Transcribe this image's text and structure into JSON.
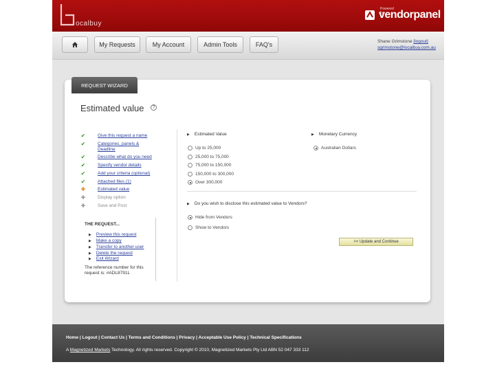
{
  "brand": {
    "logo_text": "ocalbuy",
    "powered_by": "Powered by",
    "vendorpanel": "vendorpanel"
  },
  "nav": {
    "items": [
      {
        "label": "My Requests"
      },
      {
        "label": "My Account"
      },
      {
        "label": "Admin Tools"
      },
      {
        "label": "FAQ's"
      }
    ]
  },
  "user": {
    "name": "Shane Grimstone",
    "logout": "[logout]",
    "email": "sgrimstone@localbuy.com.au"
  },
  "wizard": {
    "tab_label": "REQUEST WIZARD",
    "title": "Estimated value",
    "help": "?",
    "steps": [
      {
        "label": "Give this request a name",
        "status": "done"
      },
      {
        "label": "Categories, panels &",
        "status": "done"
      },
      {
        "label": "Describe what do you need",
        "status": "done"
      },
      {
        "label": "Specify vendor details",
        "status": "done"
      },
      {
        "label": "Add your criteria (optional)",
        "status": "done"
      },
      {
        "label": "Attached files (1)",
        "status": "done"
      },
      {
        "label": "Estimated value",
        "status": "current"
      },
      {
        "label": "Display option",
        "status": "pending"
      },
      {
        "label": "Save and Post",
        "status": "pending"
      }
    ],
    "step2_line2": "Deadline"
  },
  "request_box": {
    "heading": "THE REQUEST...",
    "actions": [
      {
        "label": "Preview this request"
      },
      {
        "label": "Make a copy"
      },
      {
        "label": "Transfer to another user"
      },
      {
        "label": "Delete the request"
      },
      {
        "label": "Exit Wizard"
      }
    ],
    "ref_line1": "The reference number for this",
    "ref_line2": "request is: #ADL8791L"
  },
  "estimated_value": {
    "heading": "Estimated Value",
    "options": [
      {
        "label": "Up to 25,000",
        "selected": false
      },
      {
        "label": "25,000 to 75,000",
        "selected": false
      },
      {
        "label": "75,000 to 150,000",
        "selected": false
      },
      {
        "label": "150,000 to 300,000",
        "selected": false
      },
      {
        "label": "Over 300,000",
        "selected": true
      }
    ]
  },
  "currency": {
    "heading": "Monetary Currency",
    "option": {
      "label": "Australian Dollars",
      "selected": true
    }
  },
  "disclose": {
    "heading": "Do you wish to disclose this estimated value to Vendors?",
    "options": [
      {
        "label": "Hide from Vendors",
        "selected": true
      },
      {
        "label": "Show to Vendors",
        "selected": false
      }
    ]
  },
  "update_button": ">> Update and Continue",
  "footer": {
    "links": "Home | Logout | Contact Us | Terms and Conditions | Privacy | Acceptable Use Policy | Technical Specifications",
    "copy_prefix": "A",
    "copy_company": "Magnetized Markets",
    "copy_rest": "Technology. All rights reserved. Copyright © 2010, Magnetized Markets Pty Ltd ABN 52 047 333 112"
  },
  "colors": {
    "header_red": "#a30d0d",
    "link_blue": "#2a3f9a",
    "check_green": "#3a9a2a",
    "current_orange": "#e08a1e"
  }
}
